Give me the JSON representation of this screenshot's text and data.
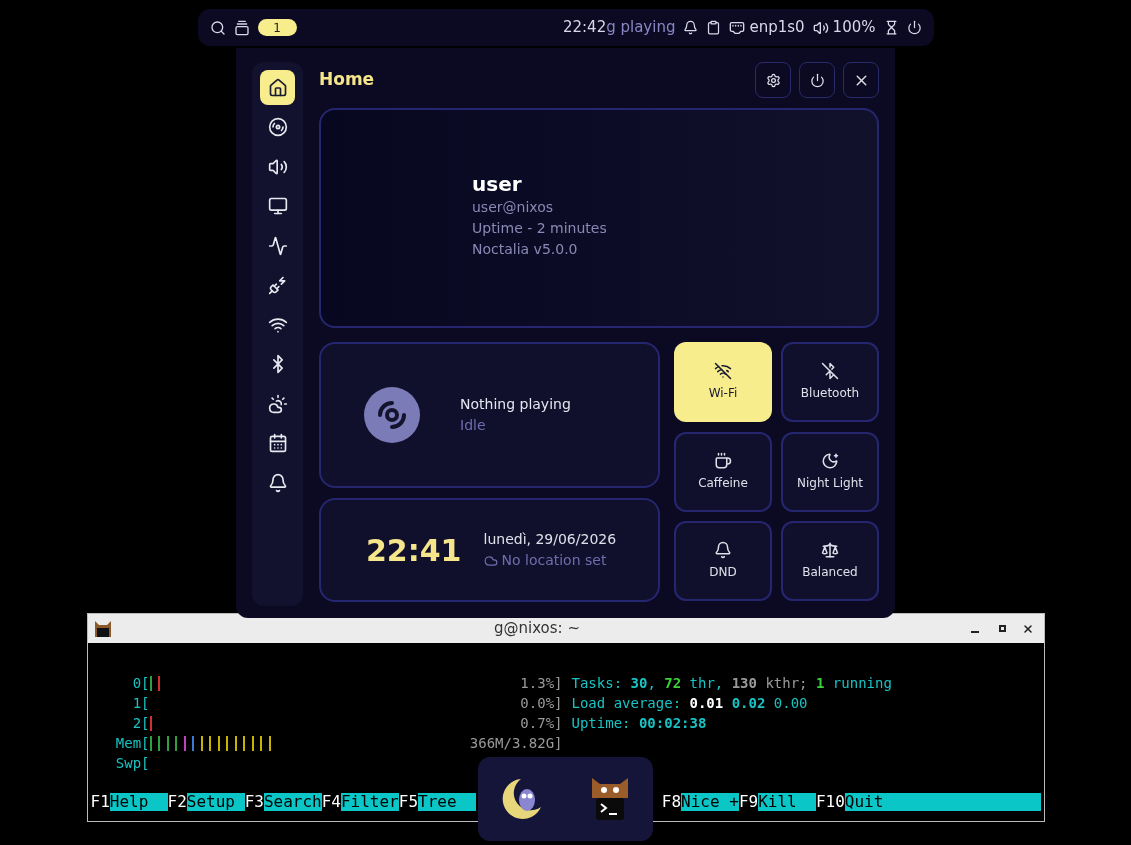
{
  "top_bar": {
    "workspace": "1",
    "time": "22:42",
    "media": "g playing",
    "network": "enp1s0",
    "volume": "100%"
  },
  "panel": {
    "title": "Home",
    "sidebar": {
      "items": [
        {
          "kind": "home",
          "selected": true
        },
        {
          "kind": "media",
          "selected": false
        },
        {
          "kind": "audio",
          "selected": false
        },
        {
          "kind": "display",
          "selected": false
        },
        {
          "kind": "system",
          "selected": false
        },
        {
          "kind": "power",
          "selected": false
        },
        {
          "kind": "wifi",
          "selected": false
        },
        {
          "kind": "bluetooth",
          "selected": false
        },
        {
          "kind": "weather",
          "selected": false
        },
        {
          "kind": "calendar",
          "selected": false
        },
        {
          "kind": "notifications",
          "selected": false
        }
      ]
    },
    "profile": {
      "name": "user",
      "host": "user@nixos",
      "uptime": "Uptime - 2 minutes",
      "version": "Noctalia v5.0.0"
    },
    "media": {
      "title": "Nothing playing",
      "status": "Idle"
    },
    "clock": {
      "time": "22:41",
      "date": "lunedì, 29/06/2026",
      "location": "No location set"
    },
    "toggles": [
      {
        "kind": "wifi",
        "label": "Wi-Fi",
        "on": true
      },
      {
        "kind": "bluetooth",
        "label": "Bluetooth",
        "on": false
      },
      {
        "kind": "caffeine",
        "label": "Caffeine",
        "on": false
      },
      {
        "kind": "night",
        "label": "Night Light",
        "on": false
      },
      {
        "kind": "dnd",
        "label": "DND",
        "on": false
      },
      {
        "kind": "balanced",
        "label": "Balanced",
        "on": false
      }
    ]
  },
  "terminal": {
    "title": "g@nixos: ~",
    "meters": [
      {
        "label": "0[",
        "bars": [
          {
            "color": "#2ea043"
          },
          {
            "color": "#d03030"
          }
        ],
        "value": "1.3%]"
      },
      {
        "label": "1[",
        "value": "0.0%]"
      },
      {
        "label": "2[",
        "bars": [
          {
            "color": "#d03030"
          }
        ],
        "value": "0.7%]"
      },
      {
        "label": "Mem[",
        "bars": [
          {
            "color": "#2ea043"
          },
          {
            "color": "#2ea043"
          },
          {
            "color": "#2ea043"
          },
          {
            "color": "#2ea043"
          },
          {
            "color": "#c040c0"
          },
          {
            "color": "#3a7ad0"
          },
          {
            "color": "#c8b400"
          },
          {
            "color": "#c8b400"
          },
          {
            "color": "#c8b400"
          },
          {
            "color": "#c8b400"
          },
          {
            "color": "#c8b400"
          },
          {
            "color": "#c8b400"
          },
          {
            "color": "#c8b400"
          },
          {
            "color": "#c8b400"
          },
          {
            "color": "#c8b400"
          }
        ],
        "value": "366M/3.82G]"
      },
      {
        "label": "Swp["
      }
    ],
    "info": [
      [
        {
          "text": "Tasks: ",
          "color": "#19c3c3"
        },
        {
          "text": "30",
          "color": "#19c3c3",
          "bold": true
        },
        {
          "text": ", ",
          "color": "#19c3c3"
        },
        {
          "text": "72",
          "color": "#3bd13b",
          "bold": true
        },
        {
          "text": " thr, ",
          "color": "#19c3c3"
        },
        {
          "text": "130",
          "color": "#9a9a9a",
          "bold": true
        },
        {
          "text": " kthr; ",
          "color": "#9a9a9a"
        },
        {
          "text": "1",
          "color": "#3bd13b",
          "bold": true
        },
        {
          "text": " running",
          "color": "#19c3c3"
        }
      ],
      [
        {
          "text": "Load average: ",
          "color": "#19c3c3"
        },
        {
          "text": "0.01",
          "color": "#ffffff",
          "bold": true
        },
        {
          "text": " 0.02",
          "color": "#19c3c3",
          "bold": true
        },
        {
          "text": " 0.00",
          "color": "#19c3c3"
        }
      ],
      [
        {
          "text": "Uptime: ",
          "color": "#19c3c3"
        },
        {
          "text": "00:02:38",
          "color": "#19c3c3",
          "bold": true
        }
      ]
    ],
    "keys_left": [
      {
        "key": "F1",
        "action": "Help  "
      },
      {
        "key": "F2",
        "action": "Setup "
      },
      {
        "key": "F3",
        "action": "Search"
      },
      {
        "key": "F4",
        "action": "Filter"
      },
      {
        "key": "F5",
        "action": "Tree  "
      }
    ],
    "keys_right": [
      {
        "key": "F8",
        "action": "Nice +"
      },
      {
        "key": "F9",
        "action": "Kill  "
      },
      {
        "key": "F10",
        "action": "Quit"
      }
    ]
  }
}
